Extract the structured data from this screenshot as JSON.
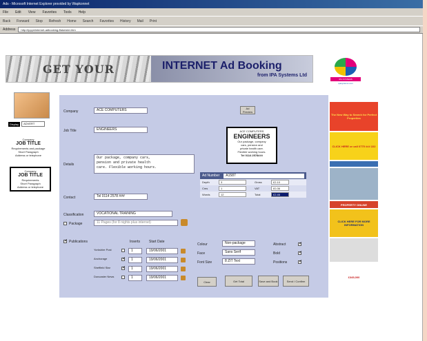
{
  "window": {
    "title": "Ads - Microsoft Internet Explorer provided by Wapkonnet",
    "menu": [
      "File",
      "Edit",
      "View",
      "Favorites",
      "Tools",
      "Help"
    ],
    "toolbar": [
      "Back",
      "Forward",
      "Stop",
      "Refresh",
      "Home",
      "Search",
      "Favorites",
      "History",
      "Mail",
      "Print"
    ],
    "address_label": "Address",
    "address_value": "http://ippyn/internet-adbooking-ffakerster.htm"
  },
  "banner": {
    "left_text": "GET YOUR",
    "title": "INTERNET Ad Booking",
    "subtitle": "from IPA Systems Ltd"
  },
  "logo": {
    "text": "IPA SYSTEMS",
    "subtext": "ipasystems.com"
  },
  "sidebar": {
    "select_tag": "Display",
    "select_value": "ADVERT",
    "card1_lines": [
      "Company",
      "JOB TITLE",
      "Requirements and package",
      "Short Paragraph",
      "Address or telephone"
    ],
    "card2_lines": [
      "Company",
      "JOB TITLE",
      "Requirements",
      "Short Paragraph",
      "Address or telephone"
    ]
  },
  "form": {
    "company_label": "Company",
    "company_value": "ACE COMPUTERS",
    "jobtitle_label": "Job Title",
    "jobtitle_value": "ENGINEERS",
    "details_label": "Details",
    "details_lines": [
      "Our package, company cars,",
      "pension and private health",
      "care.  Flexible working hours."
    ],
    "contact_label": "Contact",
    "contact_value": "Tel 0114 2578 ###",
    "classification_label": "Classification",
    "classification_value": "VOCATIONAL TRAINING",
    "package_label": "Package",
    "package_value": "11 Pages (for 8 nights plus internet)",
    "preview_button": "Ad Preview",
    "publications_label": "Publications",
    "inserts_header": "Inserts",
    "start_date_header": "Start Date",
    "publications": [
      {
        "name": "Yorkshire Post",
        "inserts": "1",
        "date": "19/06/2001",
        "checked": false
      },
      {
        "name": "Anchorage",
        "inserts": "1",
        "date": "19/06/2001",
        "checked": true
      },
      {
        "name": "Sheffield Star",
        "inserts": "1",
        "date": "19/06/2001",
        "checked": true
      },
      {
        "name": "Doncaster News",
        "inserts": "1",
        "date": "19/06/2001",
        "checked": false
      }
    ],
    "colour_label": "Colour",
    "colour_value": "Non-package",
    "face_label": "Face",
    "face_value": "Sans Serif",
    "fontsize_label": "Font Size",
    "fontsize_value": "8 ZIT Text",
    "opt_labels": [
      "Abstract",
      "Bold",
      "Positions"
    ],
    "opt_checked": [
      true,
      true,
      true
    ],
    "buttons": [
      "Clear",
      "Get Total",
      "Save and Book",
      "Send / Confirm"
    ]
  },
  "eng_box": {
    "lines_top": [
      "ACE COMPUTERS"
    ],
    "title": "ENGINEERS",
    "lines": [
      "Our package, company",
      "cars, pension and",
      "private health care.",
      "Flexible working hours."
    ],
    "tel": "Tel 0114 2578###"
  },
  "ad_table": {
    "header_label": "Ad Number",
    "header_value": "A1587",
    "rows": [
      {
        "l1": "Depth",
        "v1": "3",
        "l2": "Gross",
        "v2": "£2.10"
      },
      {
        "l1": "Cms",
        "v1": "1",
        "l2": "VAT",
        "v2": "£0.36"
      },
      {
        "l1": "Words",
        "v1": "12",
        "l2": "Total",
        "v2": "£2.46"
      }
    ]
  },
  "right_ads": [
    {
      "text": "The New Way to Search for Perfect Properties",
      "bg": "#e8432a",
      "color": "#ffe14a",
      "h": 42
    },
    {
      "text": "CLICK HERE or call 0775 ### 222",
      "bg": "#f7d21a",
      "color": "#c81e1e",
      "h": 40
    },
    {
      "text": "",
      "bg": "#3a6fb2",
      "color": "#fff",
      "h": 8
    },
    {
      "text": "",
      "bg": "#9db3c8",
      "color": "#fff",
      "h": 46
    },
    {
      "text": "PROPERTY ONLINE",
      "bg": "#d6432b",
      "color": "#fff",
      "h": 10
    },
    {
      "text": "CLICK HERE FOR MORE INFORMATION",
      "bg": "#f2c21b",
      "color": "#1c2a6e",
      "h": 40
    },
    {
      "text": "",
      "bg": "#ddd",
      "color": "#333",
      "h": 34
    },
    {
      "text": "£345,000",
      "bg": "#fff",
      "color": "#c81e1e",
      "h": 40
    }
  ]
}
